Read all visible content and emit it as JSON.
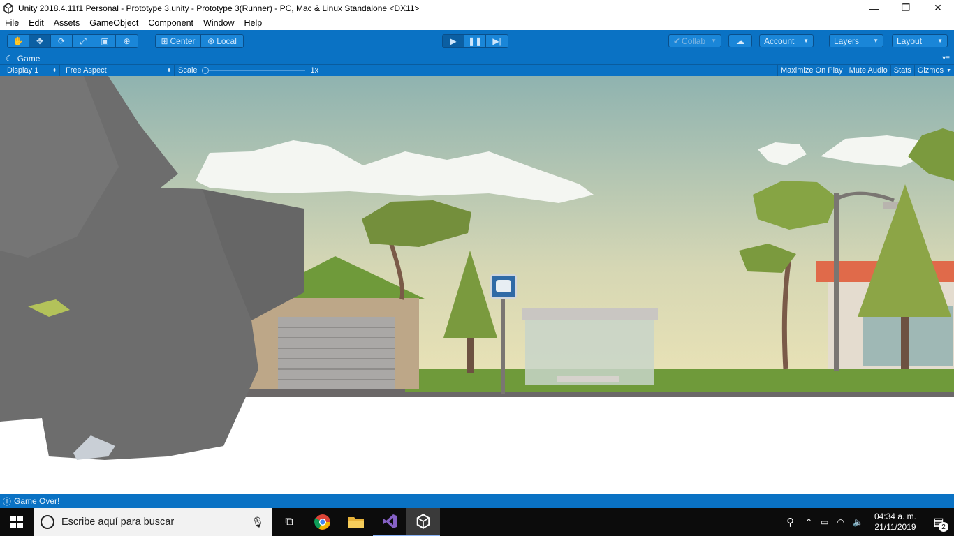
{
  "window": {
    "title": "Unity 2018.4.11f1 Personal - Prototype 3.unity - Prototype 3(Runner) - PC, Mac & Linux Standalone <DX11>",
    "minimize": "—",
    "maximize": "❐",
    "close": "✕"
  },
  "menu": [
    "File",
    "Edit",
    "Assets",
    "GameObject",
    "Component",
    "Window",
    "Help"
  ],
  "toolbar": {
    "pivot": "Center",
    "space": "Local",
    "collab": "Collab",
    "account": "Account",
    "layers": "Layers",
    "layout": "Layout"
  },
  "game_tab": {
    "title": "Game",
    "display": "Display 1",
    "aspect": "Free Aspect",
    "scale_label": "Scale",
    "scale_value": "1x",
    "maximize_on_play": "Maximize On Play",
    "mute_audio": "Mute Audio",
    "stats": "Stats",
    "gizmos": "Gizmos"
  },
  "status": {
    "message": "Game Over!"
  },
  "taskbar": {
    "search_placeholder": "Escribe aquí para buscar",
    "time": "04:34 a. m.",
    "date": "21/11/2019",
    "notifications": "2"
  },
  "colors": {
    "unity_blue": "#0a72c4",
    "sky_top": "#8fb3b0",
    "sky_bottom": "#ece4b6"
  }
}
